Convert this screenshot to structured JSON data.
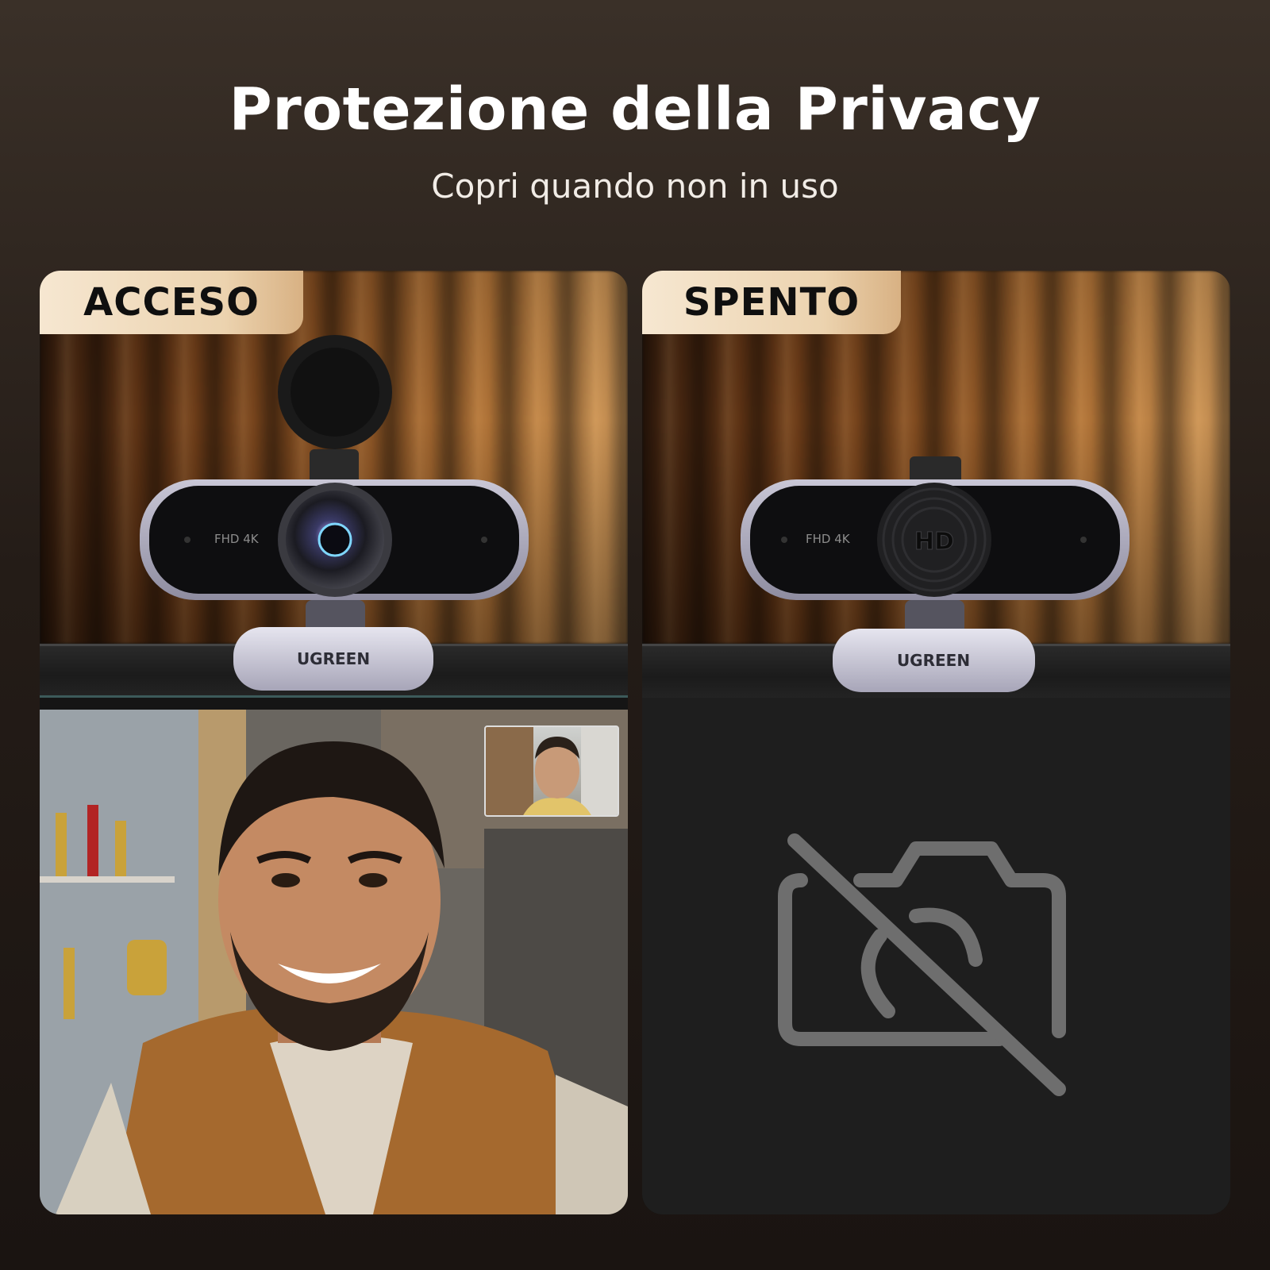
{
  "header": {
    "title": "Protezione della Privacy",
    "subtitle": "Copri quando non in uso"
  },
  "panels": [
    {
      "label": "ACCESO",
      "webcam": {
        "brand": "UGREEN",
        "model_text": "FHD 4K",
        "cover": "open"
      },
      "screen": "video-call"
    },
    {
      "label": "SPENTO",
      "webcam": {
        "brand": "UGREEN",
        "model_text": "FHD 4K",
        "cover_text": "HD",
        "cover": "closed"
      },
      "screen": "camera-off-icon"
    }
  ],
  "colors": {
    "tab_light": "#f6e7d1",
    "tab_dark": "#d8b183",
    "panel_off_bg": "#1e1e1e",
    "icon_gray": "#6e6e6e"
  }
}
